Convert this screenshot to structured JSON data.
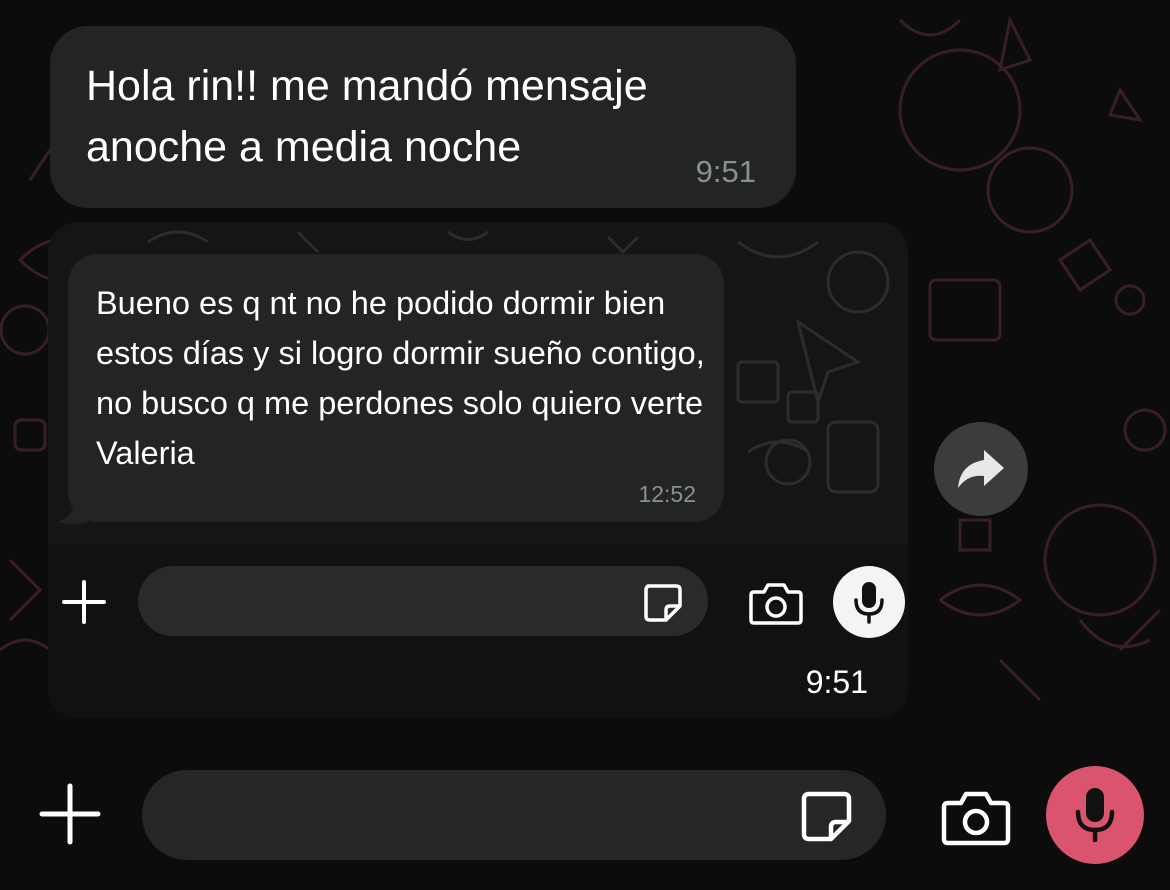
{
  "messages": {
    "top": {
      "text": "Hola rin!! me mandó mensaje anoche a media noche",
      "time": "9:51"
    },
    "forwarded_screenshot": {
      "message_text": "Bueno es q nt no he podido dormir bien estos días y si logro dormir sueño contigo, no busco q me perdones solo quiero verte Valeria",
      "message_time": "12:52",
      "screenshot_time": "9:51",
      "input_placeholder": "",
      "icons": [
        "plus-icon",
        "sticker-icon",
        "camera-icon",
        "mic-icon"
      ]
    }
  },
  "composer": {
    "placeholder": "",
    "icons": [
      "plus-icon",
      "sticker-icon",
      "camera-icon",
      "mic-icon"
    ],
    "mic_color": "#d9546c"
  },
  "forward": {
    "icon": "forward-arrow-icon"
  },
  "colors": {
    "bubble": "#232525",
    "background": "#0d0c0c",
    "wallpaper_doodle": "#3a1e26",
    "timestamp": "#8c8f8f"
  }
}
